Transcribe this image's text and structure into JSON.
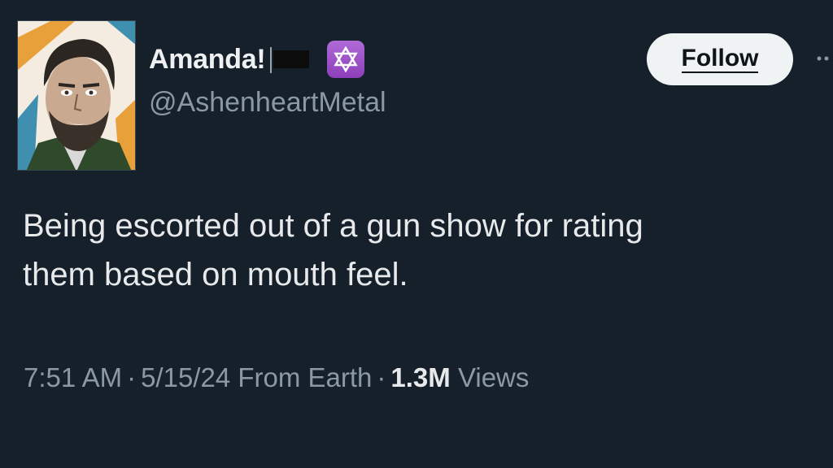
{
  "author": {
    "display_name": "Amanda!",
    "handle": "@AshenheartMetal",
    "badge_icon": "star-of-david-icon",
    "flag_icon": "black-flag-icon",
    "badge_color": "#9b4fcc"
  },
  "actions": {
    "follow_label": "Follow"
  },
  "tweet": {
    "line1": "Being escorted out of a gun show for rating",
    "line2": "them based on mouth feel."
  },
  "meta": {
    "time": "7:51 AM",
    "date": "5/15/24",
    "location": "From Earth",
    "separator": "·",
    "views_count": "1.3M",
    "views_label": "Views"
  }
}
